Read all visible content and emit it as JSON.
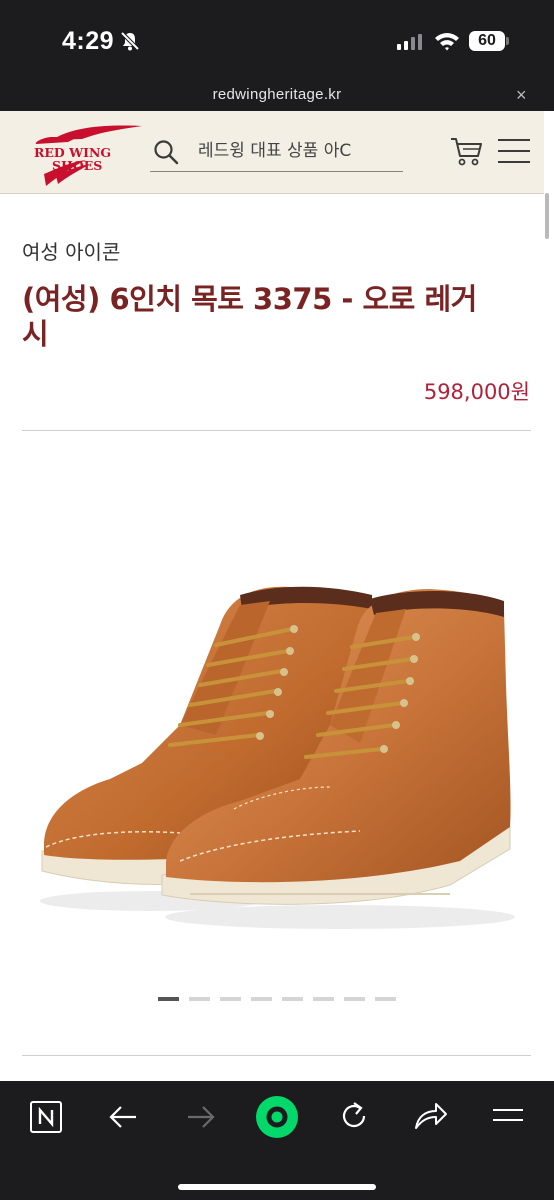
{
  "status_bar": {
    "time": "4:29",
    "battery": "60"
  },
  "browser": {
    "url": "redwingheritage.kr",
    "close_glyph": "×"
  },
  "header": {
    "logo_line1": "RED WING",
    "logo_line2": "SHOES",
    "search_placeholder": "레드윙 대표 상품 아C"
  },
  "product": {
    "category": "여성 아이콘",
    "title": "(여성) 6인치 목토 3375 - 오로 레거시",
    "price": "598,000원",
    "image_alt": "(여성) 6인치 목토 3375 - 오로 레거시",
    "carousel": {
      "count": 8,
      "active": 1
    }
  },
  "colors": {
    "brand_red": "#c8102e",
    "title_color": "#7a2323",
    "price_color": "#b0213a",
    "header_bg": "#f3efe5"
  },
  "toolbar": {
    "icons": [
      "naver-icon",
      "back-arrow-icon",
      "forward-arrow-icon",
      "green-dot-icon",
      "reload-icon",
      "share-icon",
      "menu-icon"
    ]
  }
}
